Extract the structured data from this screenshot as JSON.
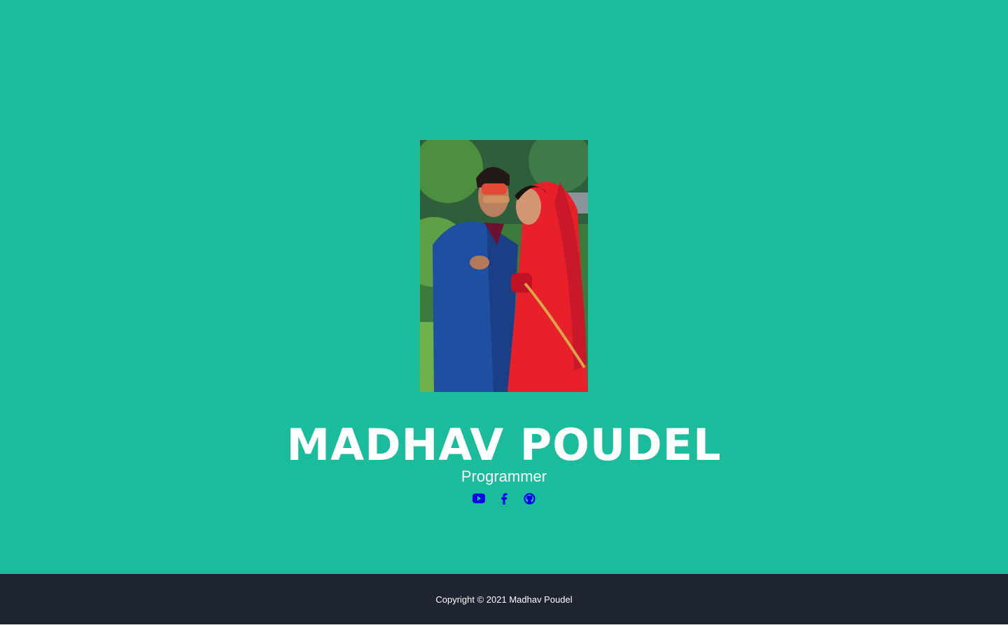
{
  "profile": {
    "photo_alt": "Madhav Poudel",
    "name": "MADHAV POUDEL",
    "role": "Programmer"
  },
  "socials": [
    {
      "icon": "youtube-icon"
    },
    {
      "icon": "facebook-icon"
    },
    {
      "icon": "github-icon"
    }
  ],
  "footer": {
    "copyright": "Copyright © 2021 Madhav Poudel"
  },
  "colors": {
    "accent": "#1abc9c",
    "footer_bg": "#1e2430",
    "text": "#ffffff",
    "icon": "#0000ee"
  }
}
